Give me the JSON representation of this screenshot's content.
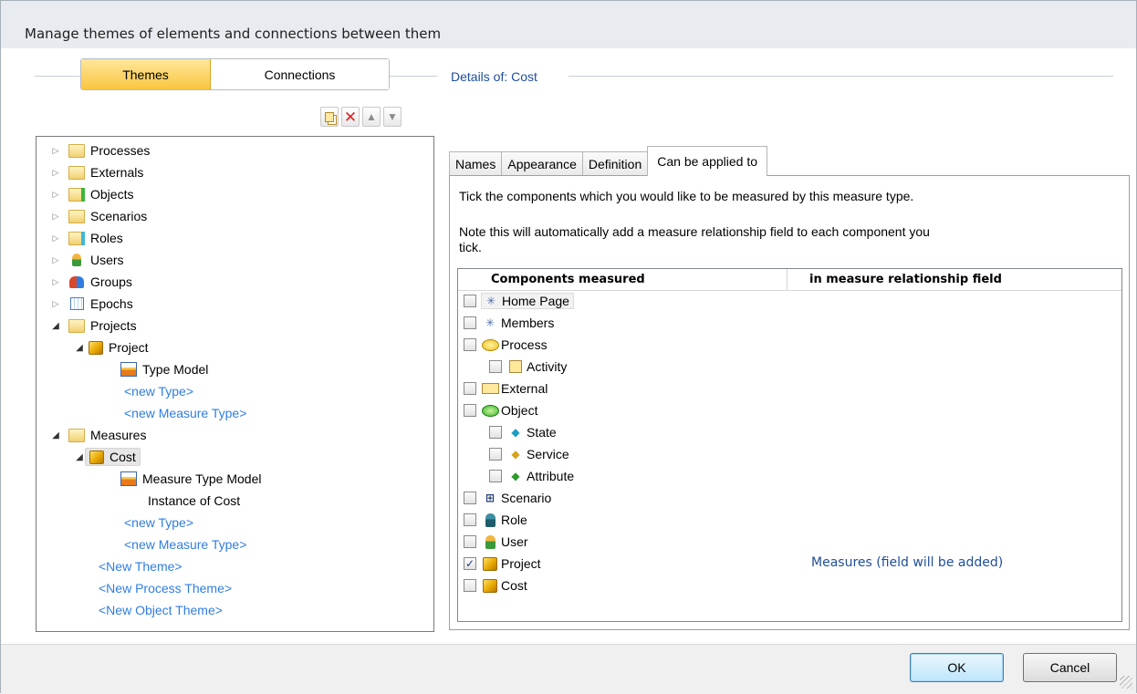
{
  "window": {
    "title": "Manage themes of elements and connections between them"
  },
  "segmented": {
    "themes": "Themes",
    "connections": "Connections"
  },
  "details": {
    "title": "Details of: Cost"
  },
  "tree": {
    "processes": "Processes",
    "externals": "Externals",
    "objects": "Objects",
    "scenarios": "Scenarios",
    "roles": "Roles",
    "users": "Users",
    "groups": "Groups",
    "epochs": "Epochs",
    "projects": "Projects",
    "project": "Project",
    "type_model": "Type Model",
    "new_type_1": "<new Type>",
    "new_measure_type_1": "<new Measure Type>",
    "measures": "Measures",
    "cost": "Cost",
    "measure_type_model": "Measure Type Model",
    "instance_of_cost": "Instance of Cost",
    "new_type_2": "<new Type>",
    "new_measure_type_2": "<new Measure Type>",
    "new_theme": "<New Theme>",
    "new_process_theme": "<New Process Theme>",
    "new_object_theme": "<New Object Theme>"
  },
  "tabs": {
    "names": "Names",
    "appearance": "Appearance",
    "definition": "Definition",
    "applied": "Can be applied to"
  },
  "instructions": {
    "line1": "Tick the components which you would like to be measured by this measure type.",
    "line2a": "Note this will automatically add a measure relationship field to each component you",
    "line2b": "tick."
  },
  "grid": {
    "col1": "Components measured",
    "col2": "in measure relationship field",
    "rows": {
      "home_page": "Home Page",
      "members": "Members",
      "process": "Process",
      "activity": "Activity",
      "external": "External",
      "object": "Object",
      "state": "State",
      "service": "Service",
      "attribute": "Attribute",
      "scenario": "Scenario",
      "role": "Role",
      "user": "User",
      "project": "Project",
      "cost": "Cost"
    },
    "project_field": "Measures (field will be added)"
  },
  "buttons": {
    "ok": "OK",
    "cancel": "Cancel"
  },
  "colors": {
    "accent": "#f9c640",
    "link": "#2f7de1",
    "heading_blue": "#1f4e9a"
  }
}
